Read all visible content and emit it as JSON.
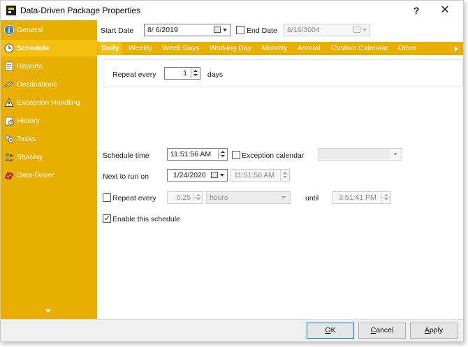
{
  "window": {
    "title": "Data-Driven Package Properties",
    "help_label": "?",
    "close_label": "✕"
  },
  "sidebar": {
    "items": [
      {
        "label": "General",
        "icon": "info-icon"
      },
      {
        "label": "Schedule",
        "icon": "clock-icon"
      },
      {
        "label": "Reports",
        "icon": "reports-icon"
      },
      {
        "label": "Destinations",
        "icon": "destinations-icon"
      },
      {
        "label": "Exception Handling",
        "icon": "warning-icon"
      },
      {
        "label": "History",
        "icon": "history-icon"
      },
      {
        "label": "Tasks",
        "icon": "tasks-icon"
      },
      {
        "label": "Sharing",
        "icon": "sharing-icon"
      },
      {
        "label": "Data-Driver",
        "icon": "data-driver-icon"
      }
    ],
    "active": "Schedule"
  },
  "dates": {
    "start_label": "Start Date",
    "start_value": "8/ 6/2019",
    "end_label": "End Date",
    "end_value": "8/16/3004"
  },
  "tabs": [
    "Daily",
    "Weekly",
    "Week Days",
    "Working Day",
    "Monthly",
    "Annual",
    "Custom Calendar",
    "Other"
  ],
  "active_tab": "Daily",
  "repeat_every": {
    "label": "Repeat every",
    "value": "1",
    "unit": "days"
  },
  "schedule": {
    "time_label": "Schedule time",
    "time_value": "11:51:56 AM",
    "exception_label": "Exception calendar",
    "exception_value": "",
    "next_run_label": "Next to run on",
    "next_run_date": "1/24/2020",
    "next_run_time": "11:51:56 AM",
    "repeat_label": "Repeat every",
    "repeat_value": "0.25",
    "repeat_unit": "hours",
    "until_label": "until",
    "until_value": "3:51:41 PM",
    "enable_label": "Enable this schedule"
  },
  "footer": {
    "ok_first": "O",
    "ok_rest": "K",
    "cancel_first": "C",
    "cancel_rest": "ancel",
    "apply_first": "A",
    "apply_rest": "pply"
  },
  "colors": {
    "sidebar": "#e8ae00",
    "active": "#f5bf10",
    "text_on_accent": "#ffffff"
  }
}
